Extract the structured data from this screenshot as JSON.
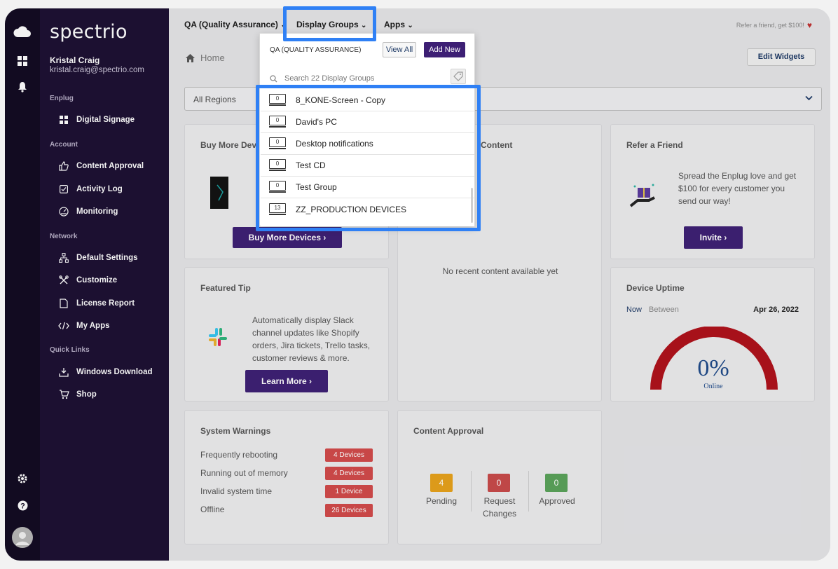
{
  "app": {
    "logo": "spectrio",
    "user_name": "Kristal Craig",
    "user_email": "kristal.craig@spectrio.com"
  },
  "sidebar": {
    "sections": [
      {
        "label": "Enplug"
      },
      {
        "label": "Account"
      },
      {
        "label": "Network"
      },
      {
        "label": "Quick Links"
      }
    ],
    "items": [
      {
        "label": "Digital Signage",
        "icon": "grid-icon"
      },
      {
        "label": "Content Approval",
        "icon": "thumbs-up-icon"
      },
      {
        "label": "Activity Log",
        "icon": "checkbox-icon"
      },
      {
        "label": "Monitoring",
        "icon": "gauge-icon"
      },
      {
        "label": "Default Settings",
        "icon": "network-icon"
      },
      {
        "label": "Customize",
        "icon": "tools-icon"
      },
      {
        "label": "License Report",
        "icon": "document-icon"
      },
      {
        "label": "My Apps",
        "icon": "code-icon"
      },
      {
        "label": "Windows Download",
        "icon": "download-icon"
      },
      {
        "label": "Shop",
        "icon": "cart-icon"
      }
    ]
  },
  "topbar": {
    "org": "QA (Quality Assurance)",
    "display_groups": "Display Groups",
    "apps": "Apps",
    "refer": "Refer a friend, get $100!"
  },
  "home": {
    "label": "Home",
    "edit_widgets": "Edit Widgets",
    "region_select": "All Regions"
  },
  "dropdown": {
    "org_header": "QA (QUALITY ASSURANCE)",
    "view_all": "View All",
    "add_new": "Add New",
    "search_placeholder": "Search 22 Display Groups",
    "groups": [
      {
        "name": "8_KONE-Screen - Copy",
        "count": "0"
      },
      {
        "name": "David's PC",
        "count": "0"
      },
      {
        "name": "Desktop notifications",
        "count": "0"
      },
      {
        "name": "Test CD",
        "count": "0"
      },
      {
        "name": "Test Group",
        "count": "0"
      },
      {
        "name": "ZZ_PRODUCTION DEVICES",
        "count": "13"
      }
    ]
  },
  "cards": {
    "buy_devices": {
      "title": "Buy More Dev",
      "button": "Buy More Devices"
    },
    "recent_content": {
      "title": "Content",
      "empty": "No recent content available yet"
    },
    "refer_friend": {
      "title": "Refer a Friend",
      "text": "Spread the Enplug love and get $100 for every customer you send our way!",
      "button": "Invite"
    },
    "featured_tip": {
      "title": "Featured Tip",
      "text": "Automatically display Slack channel updates like Shopify orders, Jira tickets, Trello tasks, customer reviews & more.",
      "button": "Learn More"
    },
    "device_uptime": {
      "title": "Device Uptime",
      "now": "Now",
      "between": "Between",
      "date": "Apr 26, 2022",
      "value": "0%",
      "value_label": "Online"
    },
    "system_warnings": {
      "title": "System Warnings",
      "rows": [
        {
          "label": "Frequently rebooting",
          "badge": "4 Devices"
        },
        {
          "label": "Running out of memory",
          "badge": "4 Devices"
        },
        {
          "label": "Invalid system time",
          "badge": "1 Device"
        },
        {
          "label": "Offline",
          "badge": "26 Devices"
        }
      ]
    },
    "content_approval": {
      "title": "Content Approval",
      "pending": {
        "count": "4",
        "label": "Pending"
      },
      "request": {
        "count": "0",
        "label": "Request Changes"
      },
      "approved": {
        "count": "0",
        "label": "Approved"
      }
    }
  },
  "colors": {
    "sidebar_bg": "#1c0f32",
    "rail_bg": "#120a21",
    "primary": "#3d1f74",
    "highlight": "#2f80f5",
    "warning_badge": "#d34a4a",
    "pending": "#e8a21a",
    "request": "#c94a4a",
    "approved": "#5aa35a",
    "gauge": "#b0101a"
  }
}
